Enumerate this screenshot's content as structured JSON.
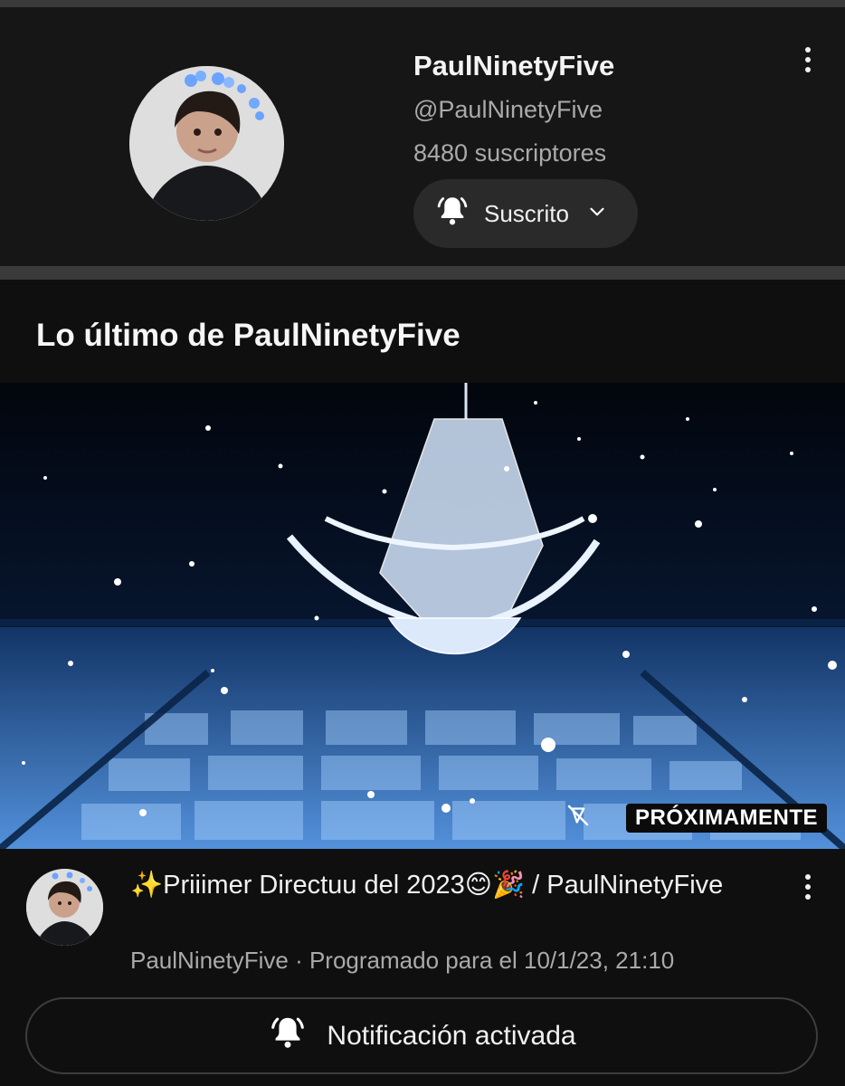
{
  "channel": {
    "name": "PaulNinetyFive",
    "handle": "@PaulNinetyFive",
    "subscribers": "8480 suscriptores",
    "subscribe_label": "Suscrito",
    "avatar_icon": "profile-photo"
  },
  "latest": {
    "title": "Lo último de PaulNinetyFive",
    "badge": "PRÓXIMAMENTE",
    "video": {
      "title": "✨Priiimer Directuu del 2023😊🎉 / PaulNinetyFive",
      "meta": "PaulNinetyFive · Programado para el 10/1/23, 21:10"
    },
    "notify_label": "Notificación activada"
  },
  "colors": {
    "background": "#0f0f0f",
    "card": "#161616",
    "button": "#2a2a2a",
    "secondary_text": "#aaaaaa"
  }
}
